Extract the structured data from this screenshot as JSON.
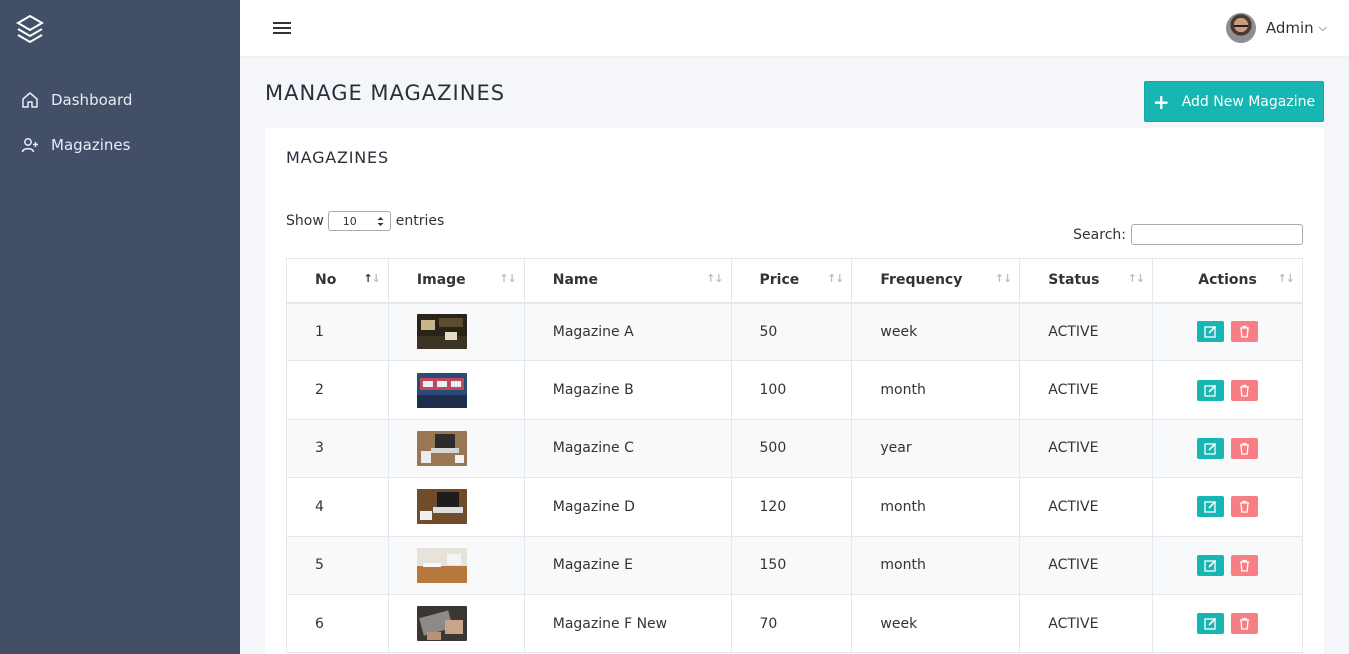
{
  "sidebar": {
    "items": [
      {
        "label": "Dashboard",
        "icon": "home-icon"
      },
      {
        "label": "Magazines",
        "icon": "user-plus-icon"
      }
    ]
  },
  "topbar": {
    "user_name": "Admin"
  },
  "page": {
    "title": "MANAGE MAGAZINES",
    "add_button_label": "Add New Magazine"
  },
  "card": {
    "title": "MAGAZINES",
    "show_label": "Show",
    "entries_value": "10",
    "entries_label": "entries",
    "search_label": "Search:",
    "search_value": ""
  },
  "table": {
    "columns": [
      "No",
      "Image",
      "Name",
      "Price",
      "Frequency",
      "Status",
      "Actions"
    ],
    "rows": [
      {
        "no": "1",
        "name": "Magazine A",
        "price": "50",
        "frequency": "week",
        "status": "ACTIVE"
      },
      {
        "no": "2",
        "name": "Magazine B",
        "price": "100",
        "frequency": "month",
        "status": "ACTIVE"
      },
      {
        "no": "3",
        "name": "Magazine C",
        "price": "500",
        "frequency": "year",
        "status": "ACTIVE"
      },
      {
        "no": "4",
        "name": "Magazine D",
        "price": "120",
        "frequency": "month",
        "status": "ACTIVE"
      },
      {
        "no": "5",
        "name": "Magazine E",
        "price": "150",
        "frequency": "month",
        "status": "ACTIVE"
      },
      {
        "no": "6",
        "name": "Magazine F New",
        "price": "70",
        "frequency": "week",
        "status": "ACTIVE"
      }
    ]
  },
  "colors": {
    "sidebar_bg": "#434e67",
    "accent": "#17b6b2",
    "danger": "#f67e84"
  }
}
